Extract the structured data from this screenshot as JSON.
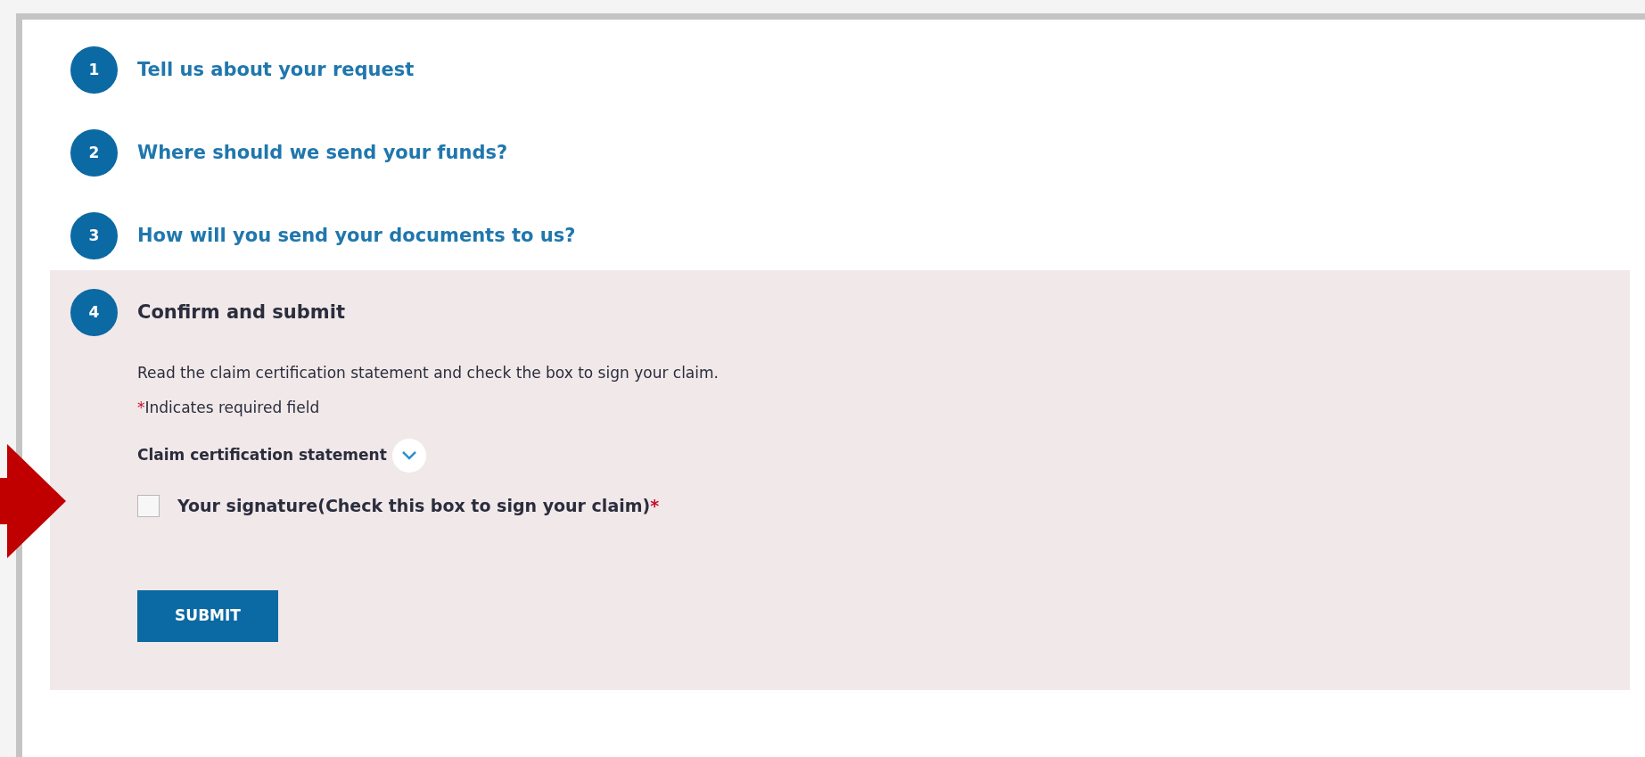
{
  "steps": [
    {
      "number": "1",
      "title": "Tell us about your request",
      "selected": false
    },
    {
      "number": "2",
      "title": "Where should we send your funds?",
      "selected": false
    },
    {
      "number": "3",
      "title": "How will you send your documents to us?",
      "selected": false
    },
    {
      "number": "4",
      "title": "Confirm and submit",
      "selected": true
    }
  ],
  "confirm": {
    "instructions": "Read the claim certification statement and check the box to sign your claim.",
    "required_mark": "*",
    "required_note": "Indicates required field",
    "statement": {
      "label": "Claim certification statement",
      "expanded": false
    },
    "signature": {
      "label": "Your signature(Check this box to sign your claim)",
      "required_mark": "*",
      "checked": false
    },
    "submit": "SUBMIT"
  }
}
